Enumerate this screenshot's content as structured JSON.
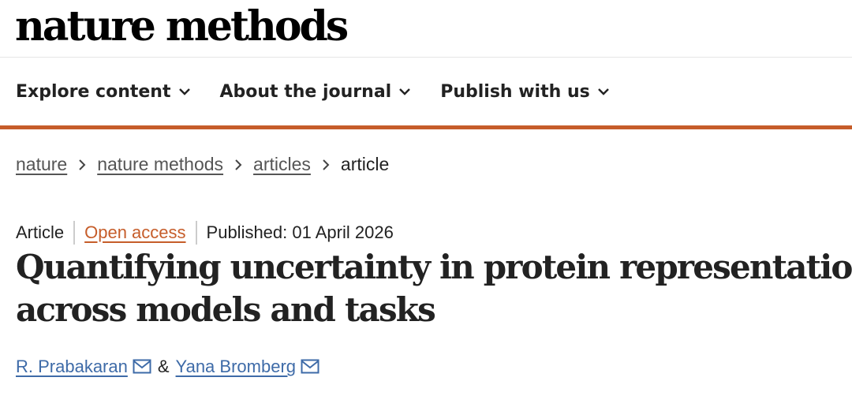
{
  "masthead": {
    "logo": "nature methods"
  },
  "nav": {
    "items": [
      {
        "label": "Explore content",
        "icon": "chevron-down-icon"
      },
      {
        "label": "About the journal",
        "icon": "chevron-down-icon"
      },
      {
        "label": "Publish with us",
        "icon": "chevron-down-icon"
      }
    ]
  },
  "breadcrumb": {
    "items": [
      "nature",
      "nature methods",
      "articles"
    ],
    "current": "article"
  },
  "article": {
    "type": "Article",
    "access": "Open access",
    "published": "Published: 01 April 2026",
    "title_line1": "Quantifying uncertainty in protein representations",
    "title_line2": "across models and tasks",
    "authors": [
      {
        "name": "R. Prabakaran",
        "icon": "mail-icon"
      },
      {
        "name": "Yana Bromberg",
        "icon": "mail-icon"
      }
    ],
    "author_separator": "&"
  },
  "colors": {
    "accent": "#c65d2a",
    "link": "#3e6ba8",
    "text": "#222222"
  }
}
